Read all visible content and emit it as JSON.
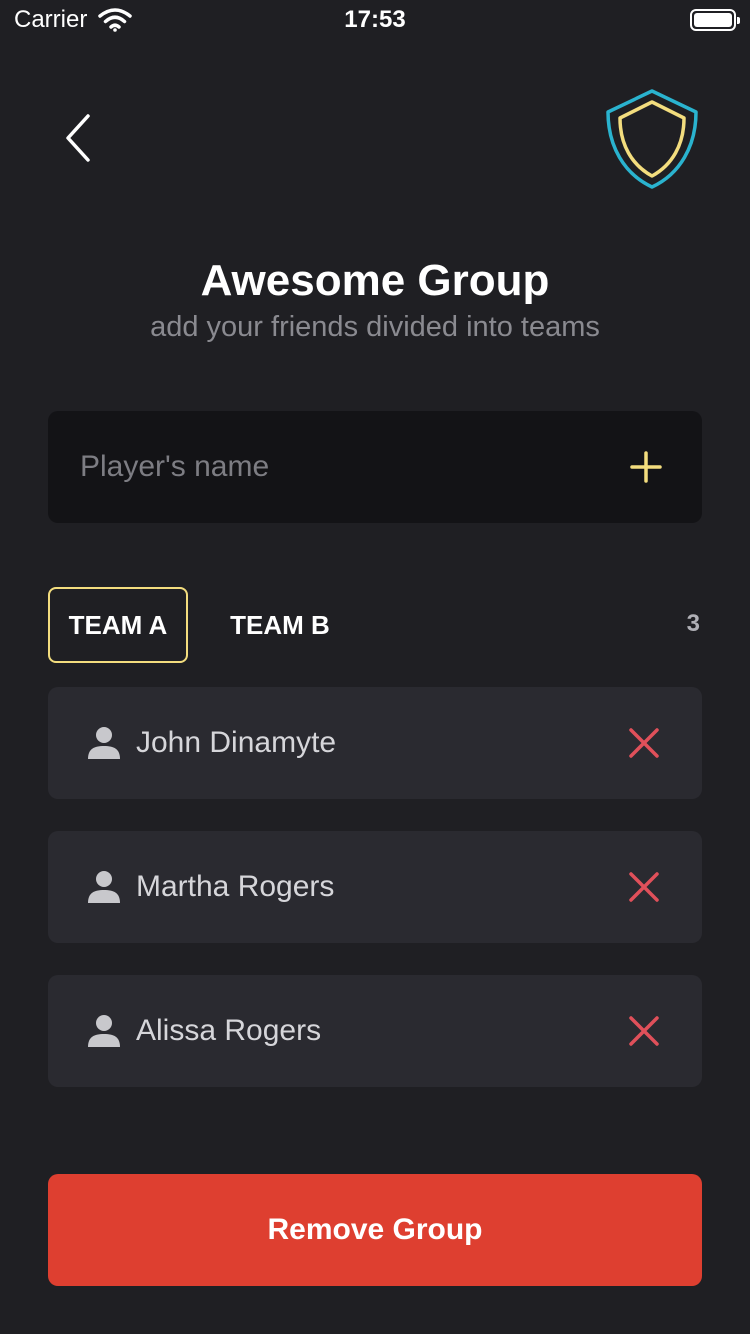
{
  "status_bar": {
    "carrier": "Carrier",
    "time": "17:53",
    "icons": [
      "wifi-icon",
      "battery-icon"
    ]
  },
  "nav": {
    "back_icon": "chevron-left-icon",
    "logo_icon": "shield-icon"
  },
  "header": {
    "title": "Awesome Group",
    "subtitle": "add your friends divided into teams"
  },
  "input": {
    "placeholder": "Player's name",
    "value": "",
    "add_icon": "plus-icon"
  },
  "tabs": [
    {
      "label": "TEAM A",
      "selected": true
    },
    {
      "label": "TEAM B",
      "selected": false
    }
  ],
  "team_count": "3",
  "players": [
    {
      "name": "John Dinamyte"
    },
    {
      "name": "Martha Rogers"
    },
    {
      "name": "Alissa Rogers"
    }
  ],
  "footer": {
    "remove_label": "Remove Group"
  },
  "colors": {
    "background": "#1f1f23",
    "input_background": "#131316",
    "row_background": "#2a2a30",
    "accent_yellow": "#f3dd7e",
    "accent_cyan": "#2ab3cf",
    "remove_icon": "#e0505a",
    "danger_button": "#de3f30"
  }
}
